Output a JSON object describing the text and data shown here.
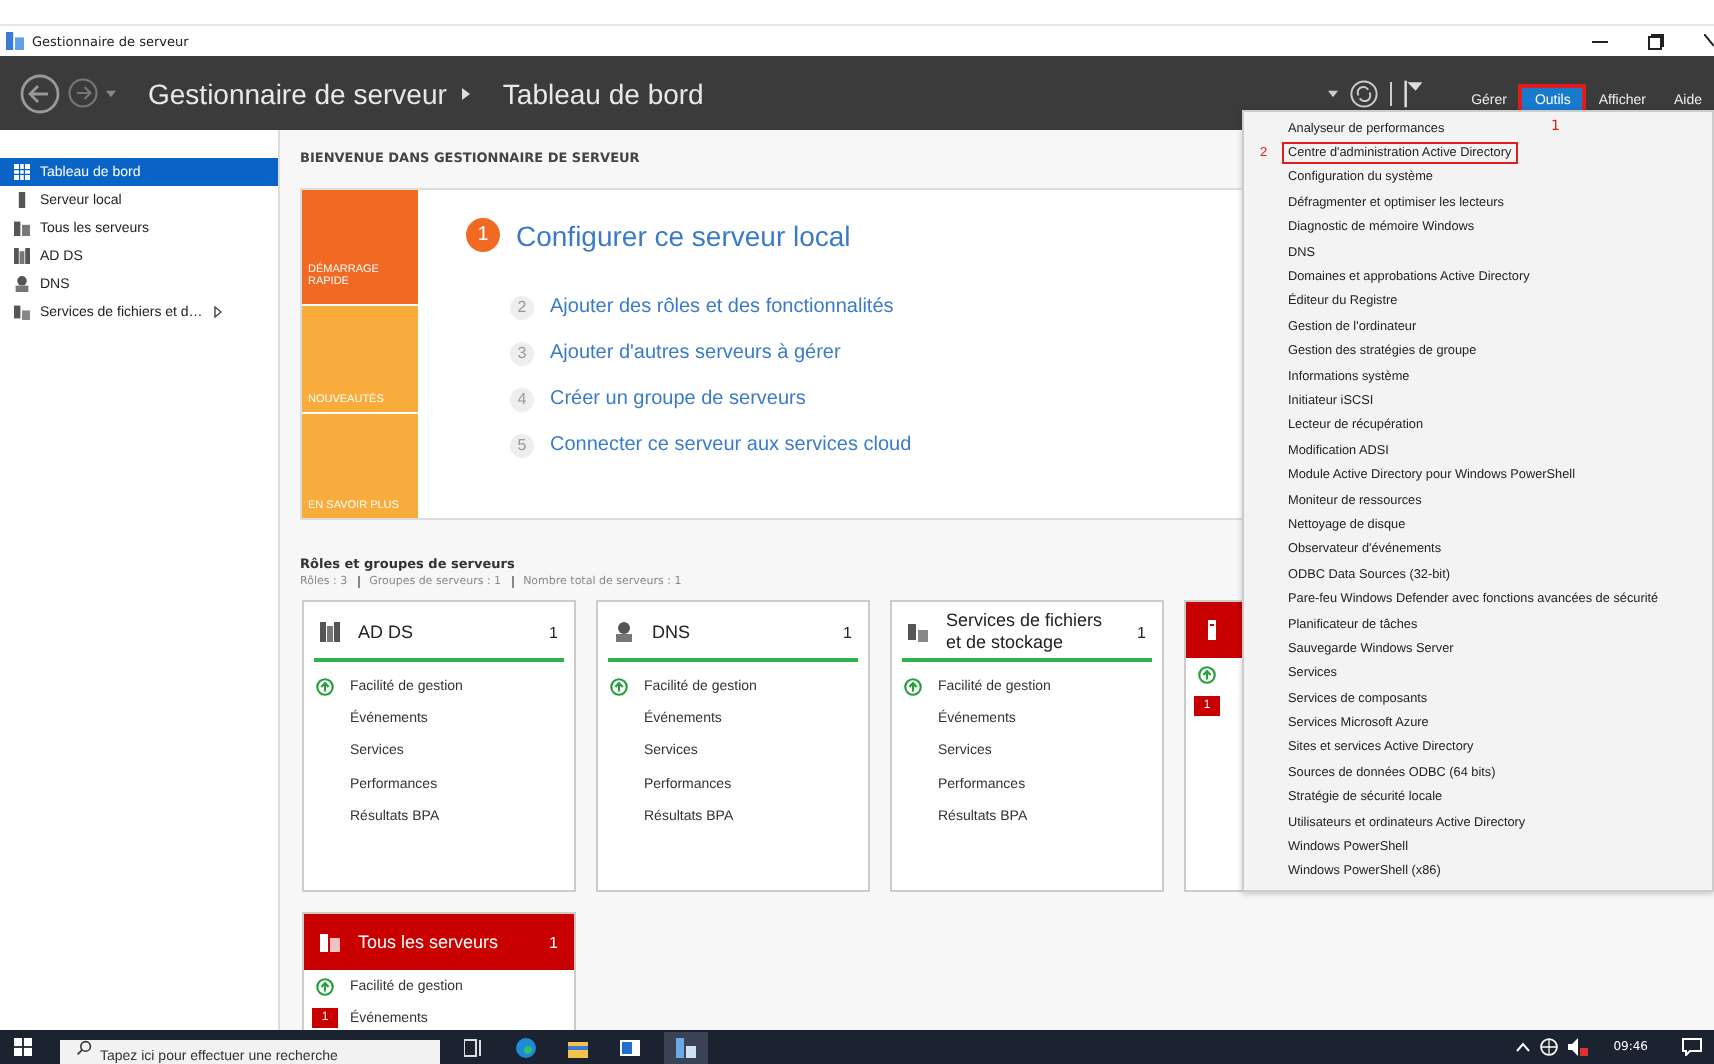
{
  "window": {
    "title": "Gestionnaire de serveur"
  },
  "header": {
    "breadcrumb": [
      "Gestionnaire de serveur",
      "Tableau de bord"
    ],
    "menus": [
      {
        "label": "Gérer",
        "selected": false
      },
      {
        "label": "Outils",
        "selected": true,
        "marker": "1"
      },
      {
        "label": "Afficher",
        "selected": false
      },
      {
        "label": "Aide",
        "selected": false
      }
    ]
  },
  "sidebar": {
    "items": [
      {
        "label": "Tableau de bord",
        "selected": true,
        "kind": "dashboard"
      },
      {
        "label": "Serveur local",
        "selected": false,
        "kind": "server"
      },
      {
        "label": "Tous les serveurs",
        "selected": false,
        "kind": "servers"
      },
      {
        "label": "AD DS",
        "selected": false,
        "kind": "adds"
      },
      {
        "label": "DNS",
        "selected": false,
        "kind": "dns"
      },
      {
        "label": "Services de fichiers et d…",
        "selected": false,
        "kind": "files",
        "expandable": true
      }
    ]
  },
  "welcome": {
    "title": "BIENVENUE DANS GESTIONNAIRE DE SERVEUR",
    "tiles": [
      {
        "label": "DÉMARRAGE RAPIDE",
        "selected": true
      },
      {
        "label": "NOUVEAUTÉS",
        "selected": false
      },
      {
        "label": "EN SAVOIR PLUS",
        "selected": false
      }
    ],
    "steps": [
      {
        "number": "1",
        "label": "Configurer ce serveur local",
        "kind": "main"
      },
      {
        "number": "2",
        "label": "Ajouter des rôles et des fonctionnalités",
        "kind": "sub"
      },
      {
        "number": "3",
        "label": "Ajouter d'autres serveurs à gérer",
        "kind": "sub"
      },
      {
        "number": "4",
        "label": "Créer un groupe de serveurs",
        "kind": "sub"
      },
      {
        "number": "5",
        "label": "Connecter ce serveur aux services cloud",
        "kind": "sub"
      }
    ]
  },
  "roles": {
    "title": "Rôles et groupes de serveurs",
    "summary": [
      "Rôles : 3",
      "Groupes de serveurs : 1",
      "Nombre total de serveurs : 1"
    ],
    "cards": [
      {
        "name": "AD DS",
        "count": "1",
        "kind": "adds",
        "alert": false,
        "rows": [
          {
            "label": "Facilité de gestion",
            "healthy": true
          },
          {
            "label": "Événements"
          },
          {
            "label": "Services"
          },
          {
            "label": "Performances"
          },
          {
            "label": "Résultats BPA"
          }
        ]
      },
      {
        "name": "DNS",
        "count": "1",
        "kind": "dns",
        "alert": false,
        "rows": [
          {
            "label": "Facilité de gestion",
            "healthy": true
          },
          {
            "label": "Événements"
          },
          {
            "label": "Services"
          },
          {
            "label": "Performances"
          },
          {
            "label": "Résultats BPA"
          }
        ]
      },
      {
        "name": "Services de fichiers et de stockage",
        "count": "1",
        "kind": "files",
        "alert": false,
        "rows": [
          {
            "label": "Facilité de gestion",
            "healthy": true
          },
          {
            "label": "Événements"
          },
          {
            "label": "Services"
          },
          {
            "label": "Performances"
          },
          {
            "label": "Résultats BPA"
          }
        ]
      },
      {
        "kind": "server",
        "alert": true,
        "rows": [
          {
            "healthy": true
          },
          {
            "badge": "1"
          }
        ]
      },
      {
        "name": "Tous les serveurs",
        "count": "1",
        "kind": "servers",
        "alert": true,
        "rows": [
          {
            "label": "Facilité de gestion",
            "healthy": true
          },
          {
            "label": "Événements",
            "badge": "1"
          }
        ]
      }
    ]
  },
  "tools_menu": {
    "items": [
      {
        "label": "Analyseur de performances"
      },
      {
        "label": "Centre d'administration Active Directory",
        "marker": "2"
      },
      {
        "label": "Configuration du système"
      },
      {
        "label": "Défragmenter et optimiser les lecteurs"
      },
      {
        "label": "Diagnostic de mémoire Windows"
      },
      {
        "label": "DNS"
      },
      {
        "label": "Domaines et approbations Active Directory"
      },
      {
        "label": "Éditeur du Registre"
      },
      {
        "label": "Gestion de l'ordinateur"
      },
      {
        "label": "Gestion des stratégies de groupe"
      },
      {
        "label": "Informations système"
      },
      {
        "label": "Initiateur iSCSI"
      },
      {
        "label": "Lecteur de récupération"
      },
      {
        "label": "Modification ADSI"
      },
      {
        "label": "Module Active Directory pour Windows PowerShell"
      },
      {
        "label": "Moniteur de ressources"
      },
      {
        "label": "Nettoyage de disque"
      },
      {
        "label": "Observateur d'événements"
      },
      {
        "label": "ODBC Data Sources (32-bit)"
      },
      {
        "label": "Pare-feu Windows Defender avec fonctions avancées de sécurité"
      },
      {
        "label": "Planificateur de tâches"
      },
      {
        "label": "Sauvegarde Windows Server"
      },
      {
        "label": "Services"
      },
      {
        "label": "Services de composants"
      },
      {
        "label": "Services Microsoft Azure"
      },
      {
        "label": "Sites et services Active Directory"
      },
      {
        "label": "Sources de données ODBC (64 bits)"
      },
      {
        "label": "Stratégie de sécurité locale"
      },
      {
        "label": "Utilisateurs et ordinateurs Active Directory"
      },
      {
        "label": "Windows PowerShell"
      },
      {
        "label": "Windows PowerShell (x86)"
      }
    ]
  },
  "taskbar": {
    "search": {
      "placeholder": "Tapez ici pour effectuer une recherche"
    },
    "time": "09:46"
  }
}
